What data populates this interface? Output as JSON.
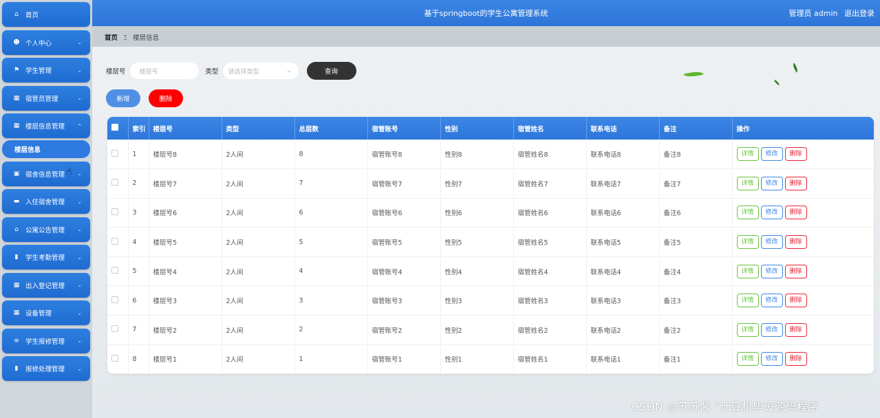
{
  "sidebar": {
    "items": [
      {
        "label": "首页",
        "icon": "home-icon",
        "glyph": "⌂"
      },
      {
        "label": "个人中心",
        "icon": "user-icon",
        "glyph": "☻"
      },
      {
        "label": "学生管理",
        "icon": "flag-icon",
        "glyph": "⚑"
      },
      {
        "label": "宿管员管理",
        "icon": "grid-icon",
        "glyph": "▦"
      },
      {
        "label": "楼层信息管理",
        "icon": "grid-icon",
        "glyph": "▦",
        "expanded": true,
        "sub": "楼层信息"
      },
      {
        "label": "宿舍信息管理",
        "icon": "clipboard-icon",
        "glyph": "▣"
      },
      {
        "label": "入住宿舍管理",
        "icon": "monitor-icon",
        "glyph": "▬"
      },
      {
        "label": "公寓公告管理",
        "icon": "bank-icon",
        "glyph": "⌂"
      },
      {
        "label": "学生考勤管理",
        "icon": "chart-icon",
        "glyph": "▮"
      },
      {
        "label": "出入登记管理",
        "icon": "grid-icon",
        "glyph": "▦"
      },
      {
        "label": "设备管理",
        "icon": "grid-icon",
        "glyph": "▦"
      },
      {
        "label": "学生报修管理",
        "icon": "list-icon",
        "glyph": "≡"
      },
      {
        "label": "报修处理管理",
        "icon": "book-icon",
        "glyph": "▮"
      }
    ]
  },
  "header": {
    "title": "基于springboot的学生公寓管理系统",
    "user": "管理员 admin",
    "logout": "退出登录"
  },
  "breadcrumb": {
    "home": "首页",
    "sep": "Ξ",
    "current": "楼层信息"
  },
  "search": {
    "floor_label": "楼层号",
    "floor_placeholder": "楼层号",
    "type_label": "类型",
    "type_placeholder": "请选择类型",
    "query_button": "查询"
  },
  "actions": {
    "add": "新增",
    "delete": "删除"
  },
  "table": {
    "headers": [
      "索引",
      "楼层号",
      "类型",
      "总层数",
      "宿管账号",
      "性别",
      "宿管姓名",
      "联系电话",
      "备注",
      "操作"
    ],
    "row_actions": {
      "detail": "详情",
      "edit": "修改",
      "delete": "删除"
    },
    "rows": [
      [
        "1",
        "楼层号8",
        "2人间",
        "8",
        "宿管账号8",
        "性别8",
        "宿管姓名8",
        "联系电话8",
        "备注8"
      ],
      [
        "2",
        "楼层号7",
        "2人间",
        "7",
        "宿管账号7",
        "性别7",
        "宿管姓名7",
        "联系电话7",
        "备注7"
      ],
      [
        "3",
        "楼层号6",
        "2人间",
        "6",
        "宿管账号6",
        "性别6",
        "宿管姓名6",
        "联系电话6",
        "备注6"
      ],
      [
        "4",
        "楼层号5",
        "2人间",
        "5",
        "宿管账号5",
        "性别5",
        "宿管姓名5",
        "联系电话5",
        "备注5"
      ],
      [
        "5",
        "楼层号4",
        "2人间",
        "4",
        "宿管账号4",
        "性别4",
        "宿管姓名4",
        "联系电话4",
        "备注4"
      ],
      [
        "6",
        "楼层号3",
        "2人间",
        "3",
        "宿管账号3",
        "性别3",
        "宿管姓名3",
        "联系电话3",
        "备注3"
      ],
      [
        "7",
        "楼层号2",
        "2人间",
        "2",
        "宿管账号2",
        "性别2",
        "宿管姓名2",
        "联系电话2",
        "备注2"
      ],
      [
        "8",
        "楼层号1",
        "2人间",
        "1",
        "宿管账号1",
        "性别1",
        "宿管姓名1",
        "联系电话1",
        "备注1"
      ]
    ]
  },
  "watermark": "CSDN @苏苏酱 °计算机毕设源码程序",
  "colors": {
    "primary": "#2d74d6",
    "danger": "#ff0000",
    "success": "#67c23a"
  }
}
